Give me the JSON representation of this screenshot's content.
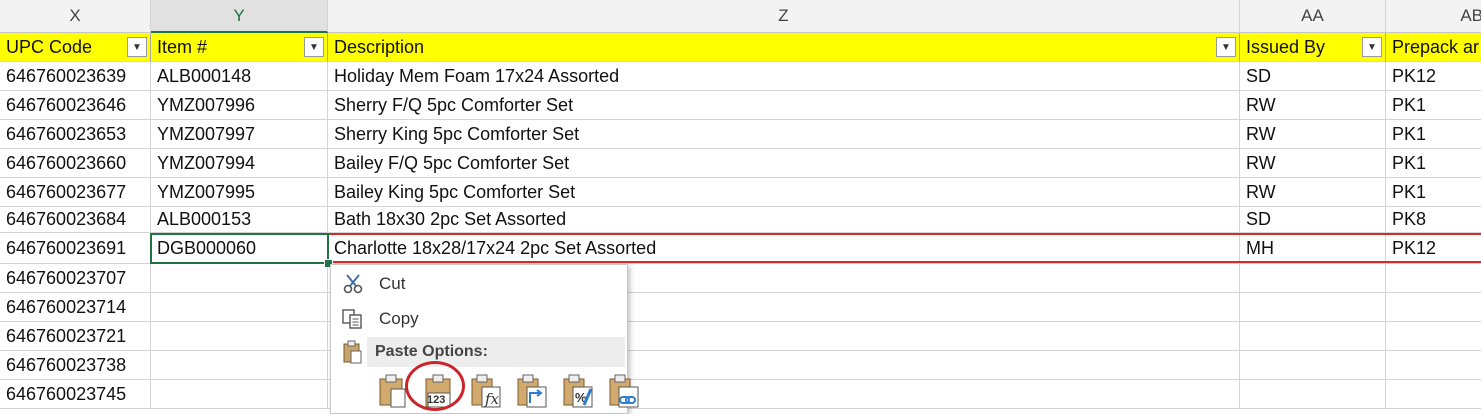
{
  "columns": [
    {
      "letter": "X"
    },
    {
      "letter": "Y",
      "selected": true
    },
    {
      "letter": "Z"
    },
    {
      "letter": "AA"
    },
    {
      "letter": "AB"
    }
  ],
  "headers": [
    "UPC Code",
    "Item #",
    "Description",
    "Issued By",
    "Prepack ar"
  ],
  "rows": [
    [
      "646760023639",
      "ALB000148",
      "Holiday Mem Foam 17x24 Assorted",
      "SD",
      "PK12"
    ],
    [
      "646760023646",
      "YMZ007996",
      "Sherry F/Q 5pc Comforter Set",
      "RW",
      "PK1"
    ],
    [
      "646760023653",
      "YMZ007997",
      "Sherry King 5pc Comforter Set",
      "RW",
      "PK1"
    ],
    [
      "646760023660",
      "YMZ007994",
      "Bailey F/Q 5pc Comforter Set",
      "RW",
      "PK1"
    ],
    [
      "646760023677",
      "YMZ007995",
      "Bailey King 5pc Comforter Set",
      "RW",
      "PK1"
    ],
    [
      "646760023684",
      "ALB000153",
      "Bath 18x30 2pc Set Assorted",
      "SD",
      "PK8"
    ],
    [
      "646760023691",
      "DGB000060",
      "Charlotte 18x28/17x24 2pc Set Assorted",
      "MH",
      "PK12"
    ],
    [
      "646760023707",
      "",
      "",
      "",
      ""
    ],
    [
      "646760023714",
      "",
      "",
      "",
      ""
    ],
    [
      "646760023721",
      "",
      "",
      "",
      ""
    ],
    [
      "646760023738",
      "",
      "",
      "",
      ""
    ],
    [
      "646760023745",
      "",
      "",
      "",
      ""
    ]
  ],
  "context_menu": {
    "cut": "Cut",
    "copy": "Copy",
    "paste_options": "Paste Options:",
    "paste_values_badge": "123"
  },
  "colors": {
    "header_fill": "#ffff00",
    "excel_green": "#217346",
    "highlight_red": "#d62b2b"
  }
}
